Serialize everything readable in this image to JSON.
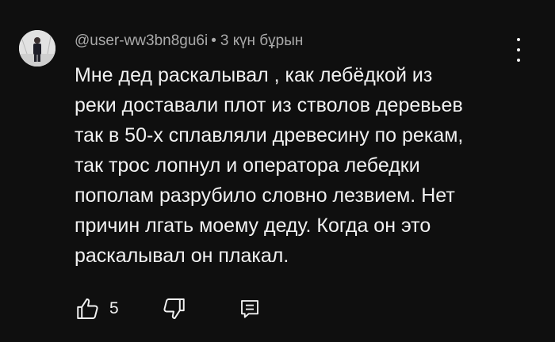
{
  "comment": {
    "author": "@user-ww3bn8gu6i",
    "separator": "•",
    "timestamp": "3 күн бұрын",
    "text_lines": [
      "Мне дед раскалывал , как лебёдкой из",
      "реки доставали плот из стволов деревьев",
      "так в 50-х сплавляли древесину по рекам,",
      "так трос лопнул и оператора лебедки",
      "пополам разрубило словно лезвием. Нет",
      "причин лгать моему деду. Когда он это",
      "раскалывал он плакал."
    ],
    "like_count": "5"
  },
  "icons": {
    "avatar": "avatar-photo",
    "menu": "more-vertical-icon",
    "like": "thumbs-up-icon",
    "dislike": "thumbs-down-icon",
    "reply": "reply-comment-icon"
  },
  "colors": {
    "background": "#0f0f0f",
    "text": "#f1f1f1",
    "secondary_text": "#aaaaaa"
  }
}
